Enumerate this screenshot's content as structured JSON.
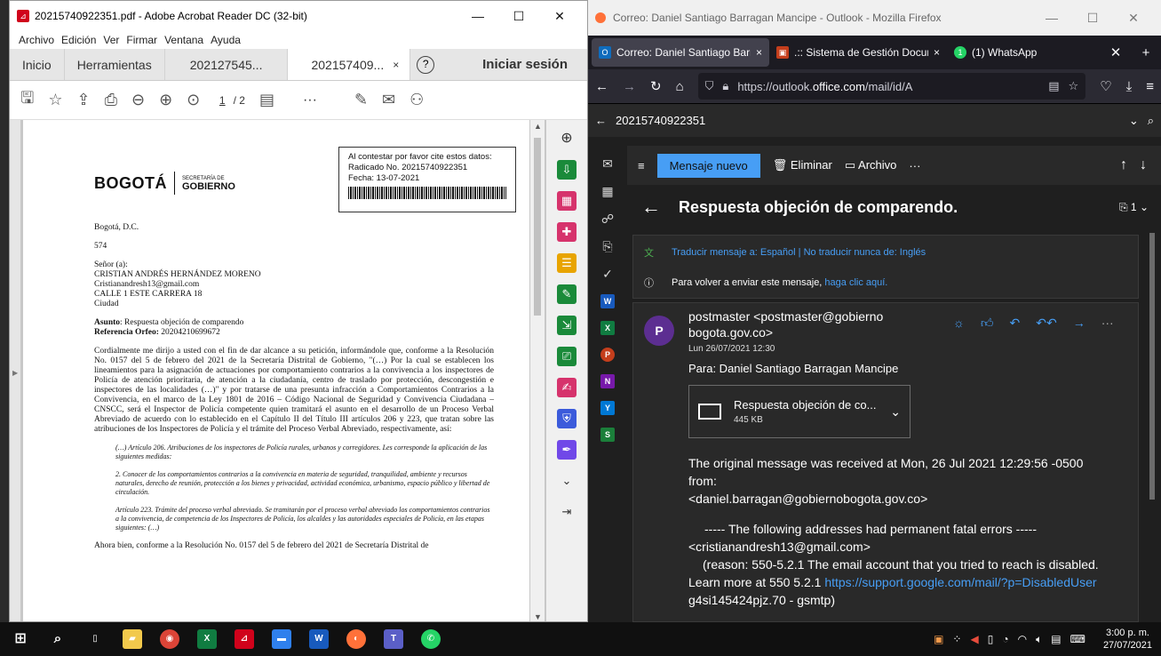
{
  "acrobat": {
    "window_title": "20215740922351.pdf - Adobe Acrobat Reader DC (32-bit)",
    "menu": [
      "Archivo",
      "Edición",
      "Ver",
      "Firmar",
      "Ventana",
      "Ayuda"
    ],
    "tabs": [
      "Inicio",
      "Herramientas",
      "202127545...",
      "202157409..."
    ],
    "tab_close": "×",
    "help": "?",
    "signin": "Iniciar sesión",
    "page_current": "1",
    "page_total": "/ 2",
    "more": "···",
    "stamp": {
      "line1": "Al contestar por favor cite estos datos:",
      "line2": "Radicado No. 20215740922351",
      "line3": "Fecha: 13-07-2021"
    },
    "logo": {
      "brand": "BOGOTÁ",
      "sec_small": "SECRETARÍA DE",
      "sec_big": "GOBIERNO"
    },
    "doc": {
      "city": "Bogotá, D.C.",
      "number": "574",
      "salutation": "Señor (a):",
      "name": "CRISTIAN ANDRÉS HERNÁNDEZ MORENO",
      "email": "Cristianandresh13@gmail.com",
      "address": "CALLE 1 ESTE CARRERA 18",
      "city2": "Ciudad",
      "subject_label": "Asunto",
      "subject": ": Respuesta objeción de comparendo",
      "ref_label": "Referencia Orfeo:",
      "ref": " 20204210699672",
      "para1": "Cordialmente me dirijo a usted con el fin de dar alcance a su petición, informándole que, conforme a la Resolución No. 0157 del 5 de febrero del 2021 de la Secretaría Distrital de Gobierno, \"(…) Por la cual se establecen los lineamientos para la asignación de actuaciones por comportamiento contrarios a la convivencia a los inspectores de Policía de atención prioritaria, de atención a la ciudadanía, centro de traslado por protección, descongestión e inspectores de las localidades (…)\" y por tratarse de una presunta infracción a Comportamientos Contrarios a la Convivencia, en el marco de la Ley 1801 de 2016 – Código Nacional de Seguridad y Convivencia Ciudadana – CNSCC, será el Inspector de Policía competente quien tramitará el asunto en el desarrollo de un Proceso Verbal Abreviado de acuerdo con lo establecido en el Capítulo II del Título III artículos 206 y 223, que tratan sobre las atribuciones de los Inspectores de Policía y el trámite del Proceso Verbal Abreviado, respectivamente, así:",
      "quote1": "(…) Artículo 206. Atribuciones de los inspectores de Policía rurales, urbanos y corregidores. Les corresponde la aplicación de las siguientes medidas:",
      "quote2": "2. Conocer de los comportamientos contrarios a la convivencia en materia de seguridad, tranquilidad, ambiente y recursos naturales, derecho de reunión, protección a los bienes y privacidad, actividad económica, urbanismo, espacio público y libertad de circulación.",
      "quote3": "Artículo 223. Trámite del proceso verbal abreviado. Se tramitarán por el proceso verbal abreviado los comportamientos contrarios a la convivencia, de competencia de los Inspectores de Policía, los alcaldes y las autoridades especiales de Policía, en las etapas siguientes: (…)",
      "para2": "Ahora bien, conforme a la Resolución No. 0157 del 5 de febrero del 2021 de Secretaría Distrital de"
    }
  },
  "firefox": {
    "window_title": "Correo: Daniel Santiago Barragan Mancipe - Outlook - Mozilla Firefox",
    "tabs": [
      {
        "label": "Correo: Daniel Santiago Barra",
        "fav": "O",
        "color": "#0f6cbd"
      },
      {
        "label": ".:: Sistema de Gestión Docum",
        "fav": "▣",
        "color": "#c43e1c"
      },
      {
        "label": "(1) WhatsApp",
        "fav": "1",
        "color": "#25d366"
      }
    ],
    "tab_close": "×",
    "url_prefix": "https://outlook.",
    "url_domain": "office.com",
    "url_rest": "/mail/id/A",
    "search_query": "20215740922351"
  },
  "outlook": {
    "new_message": "Mensaje nuevo",
    "delete": "Eliminar",
    "archive": "Archivo",
    "more": "···",
    "subject": "Respuesta objeción de comparendo.",
    "attach_count": "1",
    "translate": "Traducir mensaje a: Español | No traducir nunca de: Inglés",
    "resend_prefix": "Para volver a enviar este mensaje, ",
    "resend_link": "haga clic aquí.",
    "avatar": "P",
    "from_line1": "postmaster <postmaster@gobierno",
    "from_line2": "bogota.gov.co>",
    "date": "Lun 26/07/2021 12:30",
    "to": "Para:  Daniel Santiago Barragan Mancipe",
    "attachment_name": "Respuesta objeción de co...",
    "attachment_size": "445 KB",
    "body": {
      "l1": "The original message was received at Mon, 26 Jul 2021 12:29:56 -0500",
      "l2": "from:",
      "l3": "<daniel.barragan@gobiernobogota.gov.co>",
      "l4": "----- The following addresses had permanent fatal errors -----",
      "l5": "<cristianandresh13@gmail.com>",
      "l6": "(reason: 550-5.2.1 The email account that you tried to reach is disabled.",
      "l7_prefix": "Learn more at 550 5.2.1 ",
      "l7_link": "https://support.google.com/mail/?p=DisabledUser",
      "l8": "g4si145424pjz.70 - gsmtp)"
    }
  },
  "taskbar": {
    "time": "3:00 p. m.",
    "date": "27/07/2021"
  }
}
